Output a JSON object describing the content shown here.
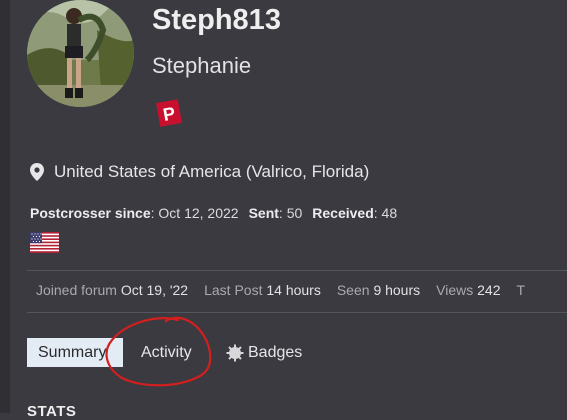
{
  "profile": {
    "username": "Steph813",
    "full_name": "Stephanie",
    "avatar_icon": "profile-photo",
    "badge_icon": "postcrossing-logo",
    "badge_letter": "P"
  },
  "location": {
    "icon": "map-pin-icon",
    "text": "United States of America (Valrico, Florida)"
  },
  "postcrossing": {
    "since_label": "Postcrosser since",
    "since_value": ": Oct 12, 2022",
    "sent_label": "Sent",
    "sent_value": ": 50",
    "received_label": "Received",
    "received_value": ": 48",
    "flag_icon": "us-flag-icon"
  },
  "forum": {
    "joined_label": "Joined forum",
    "joined_value": "Oct 19, '22",
    "lastpost_label": "Last Post",
    "lastpost_value": "14 hours",
    "seen_label": "Seen",
    "seen_value": "9 hours",
    "views_label": "Views",
    "views_value": "242",
    "trailing": "T"
  },
  "tabs": [
    {
      "label": "Summary",
      "active": true
    },
    {
      "label": "Activity",
      "active": false
    },
    {
      "label": "Badges",
      "active": false,
      "icon": "gear-icon"
    }
  ],
  "section": {
    "heading": "STATS"
  },
  "colors": {
    "background": "#3a3a40",
    "active_tab_bg": "#e3ecf4",
    "annotation": "#d41f1f",
    "badge_red": "#c8102e"
  }
}
